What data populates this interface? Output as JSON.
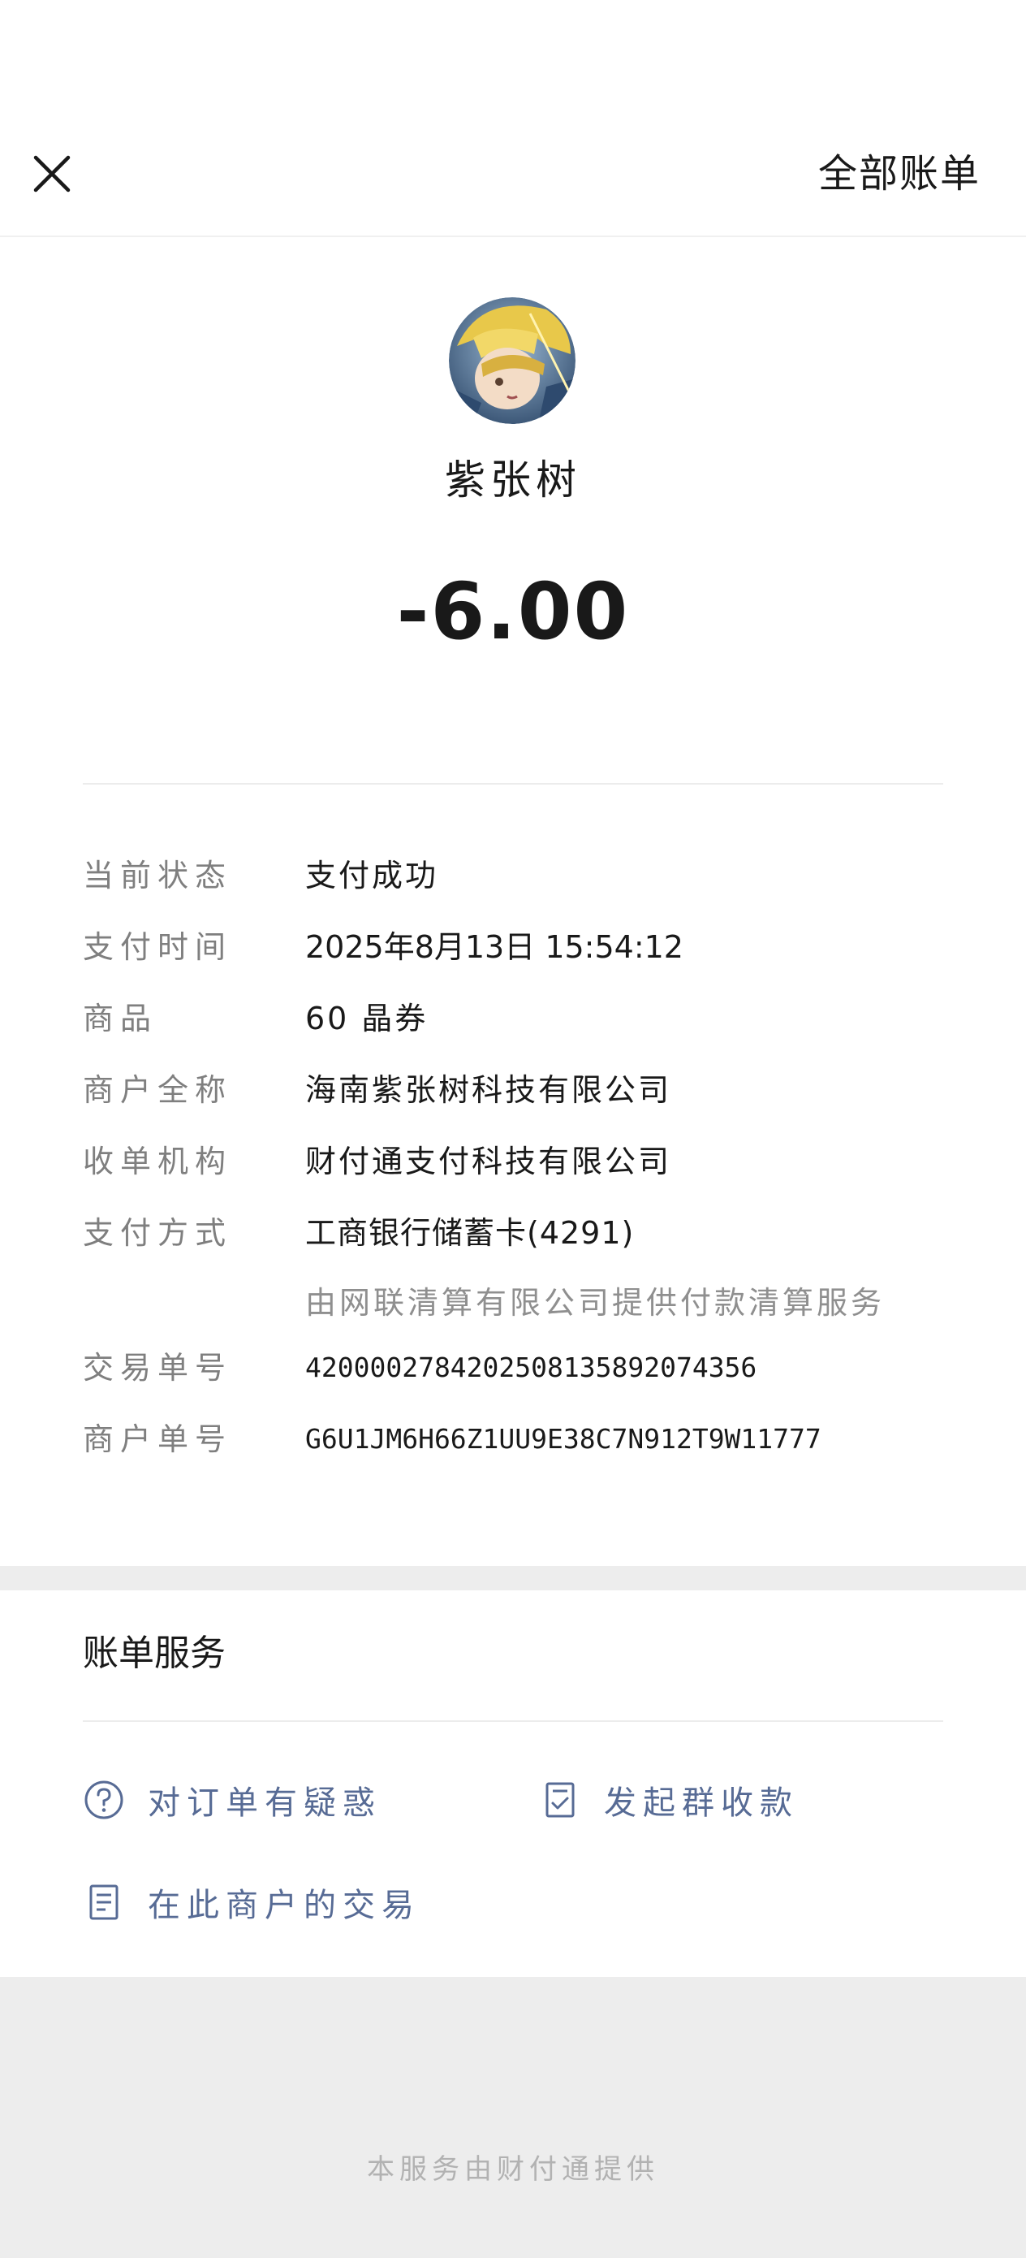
{
  "nav": {
    "all_bills_label": "全部账单"
  },
  "merchant": {
    "name": "紫张树",
    "amount": "-6.00"
  },
  "details": [
    {
      "label": "当前状态",
      "value": "支付成功"
    },
    {
      "label": "支付时间",
      "value": "2025年8月13日 15:54:12"
    },
    {
      "label": "商品",
      "value": "60 晶券"
    },
    {
      "label": "商户全称",
      "value": "海南紫张树科技有限公司"
    },
    {
      "label": "收单机构",
      "value": "财付通支付科技有限公司"
    },
    {
      "label": "支付方式",
      "value": "工商银行储蓄卡(4291)",
      "sub": "由网联清算有限公司提供付款清算服务"
    },
    {
      "label": "交易单号",
      "value": "4200002784202508135892074356"
    },
    {
      "label": "商户单号",
      "value": "G6U1JM6H66Z1UU9E38C7N912T9W11777"
    }
  ],
  "services": {
    "title": "账单服务",
    "items": [
      {
        "label": "对订单有疑惑",
        "icon": "question-circle-icon"
      },
      {
        "label": "发起群收款",
        "icon": "checklist-doc-icon"
      },
      {
        "label": "在此商户的交易",
        "icon": "document-list-icon"
      }
    ]
  },
  "footer": {
    "text": "本服务由财付通提供"
  },
  "colors": {
    "link": "#576b95",
    "label": "#7f7f7f",
    "background": "#ededed"
  }
}
